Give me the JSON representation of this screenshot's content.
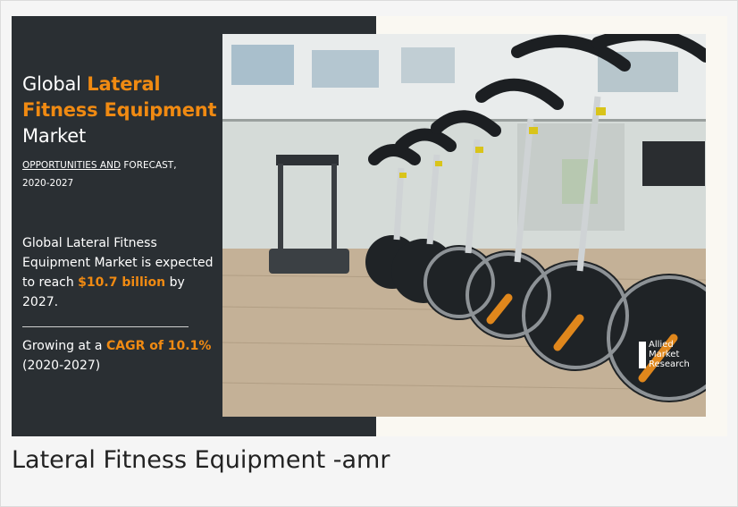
{
  "banner": {
    "title_word1": "Global ",
    "title_word2": "Lateral",
    "title_line2": "Fitness Equipment",
    "title_line3": "Market",
    "subtitle_part1": "OPPORTUNITIES AND",
    "subtitle_part2": " FORECAST,",
    "subtitle_line2": "2020-2027",
    "stat1_text": "Global Lateral Fitness Equipment Market is expected to reach ",
    "stat1_value": "$10.7 billion",
    "stat1_suffix": " by 2027.",
    "stat2_prefix": "Growing at a ",
    "stat2_value": "CAGR of 10.1%",
    "stat2_suffix": "(2020-2027)",
    "brand_line1": "Allied",
    "brand_line2": "Market",
    "brand_line3": "Research"
  },
  "caption": {
    "text": "Lateral Fitness Equipment -amr"
  },
  "colors": {
    "accent": "#f08a12",
    "panel": "#2a2f33",
    "caption_text": "#222222"
  },
  "icons": {
    "brand_logo": "allied-market-research-logo"
  }
}
